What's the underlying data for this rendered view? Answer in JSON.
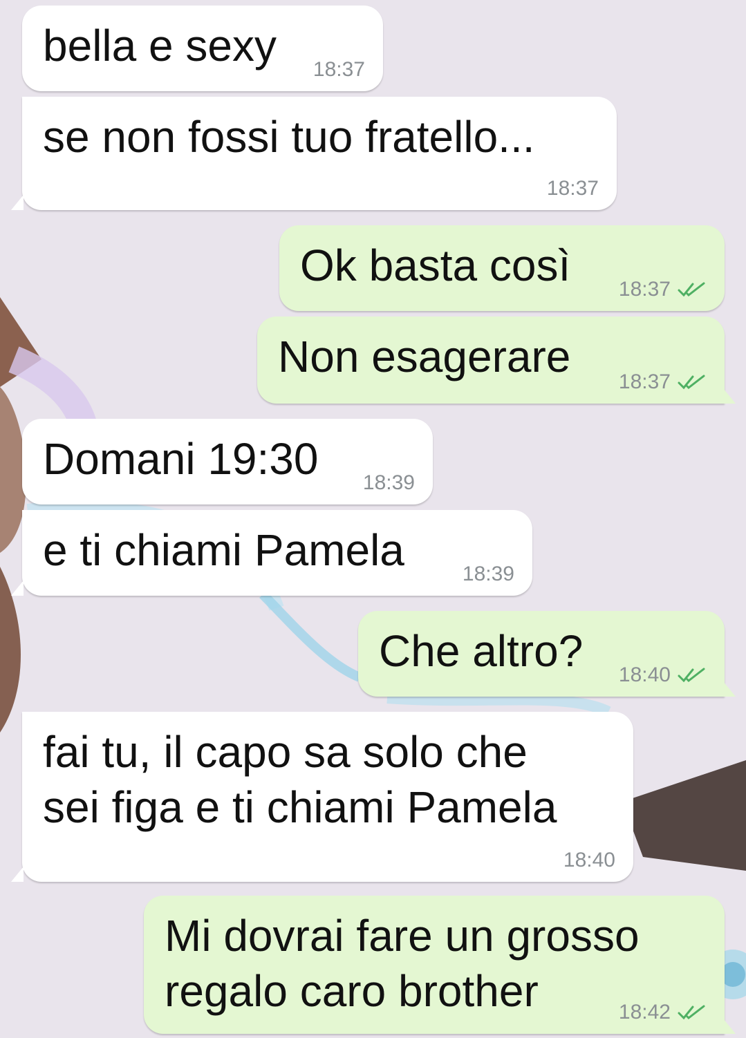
{
  "chat": {
    "messages": [
      {
        "direction": "incoming",
        "text": "bella e sexy",
        "time": "18:37"
      },
      {
        "direction": "incoming",
        "text": "se non fossi tuo fratello...",
        "time": "18:37"
      },
      {
        "direction": "outgoing",
        "text": "Ok basta così",
        "time": "18:37",
        "status": "read"
      },
      {
        "direction": "outgoing",
        "text": "Non esagerare",
        "time": "18:37",
        "status": "read"
      },
      {
        "direction": "incoming",
        "text": "Domani 19:30",
        "time": "18:39"
      },
      {
        "direction": "incoming",
        "text": "e ti chiami Pamela",
        "time": "18:39"
      },
      {
        "direction": "outgoing",
        "text": "Che altro?",
        "time": "18:40",
        "status": "read"
      },
      {
        "direction": "incoming",
        "text": "fai tu, il capo sa solo che\nsei figa e ti chiami Pamela",
        "time": "18:40"
      },
      {
        "direction": "outgoing",
        "text": "Mi dovrai fare un grosso\nregalo caro brother",
        "time": "18:42",
        "status": "read"
      }
    ]
  },
  "colors": {
    "incoming_bubble": "#ffffff",
    "outgoing_bubble": "#e4f7d2",
    "timestamp": "#8a8f93",
    "read_tick": "#4fb063"
  },
  "icons": {
    "read_receipt": "double-check-icon"
  }
}
